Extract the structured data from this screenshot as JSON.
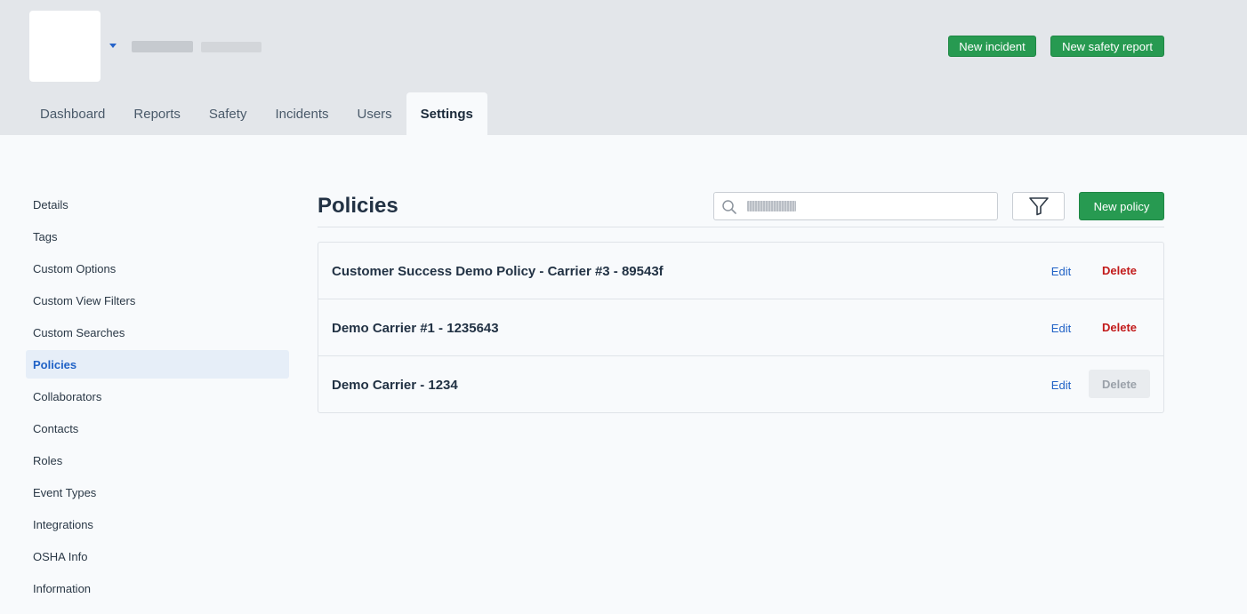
{
  "header": {
    "buttons": {
      "new_incident": "New incident",
      "new_safety_report": "New safety report"
    },
    "tabs": [
      {
        "label": "Dashboard",
        "active": false
      },
      {
        "label": "Reports",
        "active": false
      },
      {
        "label": "Safety",
        "active": false
      },
      {
        "label": "Incidents",
        "active": false
      },
      {
        "label": "Users",
        "active": false
      },
      {
        "label": "Settings",
        "active": true
      }
    ]
  },
  "sidebar": {
    "items": [
      {
        "label": "Details",
        "active": false
      },
      {
        "label": "Tags",
        "active": false
      },
      {
        "label": "Custom Options",
        "active": false
      },
      {
        "label": "Custom View Filters",
        "active": false
      },
      {
        "label": "Custom Searches",
        "active": false
      },
      {
        "label": "Policies",
        "active": true
      },
      {
        "label": "Collaborators",
        "active": false
      },
      {
        "label": "Contacts",
        "active": false
      },
      {
        "label": "Roles",
        "active": false
      },
      {
        "label": "Event Types",
        "active": false
      },
      {
        "label": "Integrations",
        "active": false
      },
      {
        "label": "OSHA Info",
        "active": false
      },
      {
        "label": "Information",
        "active": false
      }
    ]
  },
  "main": {
    "title": "Policies",
    "search": {
      "value": ""
    },
    "new_policy_label": "New policy",
    "policies": [
      {
        "name": "Customer Success Demo Policy - Carrier #3 - 89543f",
        "edit_label": "Edit",
        "delete_label": "Delete",
        "delete_enabled": true
      },
      {
        "name": "Demo Carrier #1 - 1235643",
        "edit_label": "Edit",
        "delete_label": "Delete",
        "delete_enabled": true
      },
      {
        "name": "Demo Carrier - 1234",
        "edit_label": "Edit",
        "delete_label": "Delete",
        "delete_enabled": false
      }
    ]
  },
  "colors": {
    "primary_green": "#279a51",
    "link_blue": "#2062c6",
    "danger_red": "#c21a1a",
    "header_bg": "#e3e6ea",
    "page_bg": "#f8fafc"
  },
  "icons": {
    "org_menu": "caret-down-icon",
    "search": "search-icon",
    "filter": "filter-icon"
  }
}
